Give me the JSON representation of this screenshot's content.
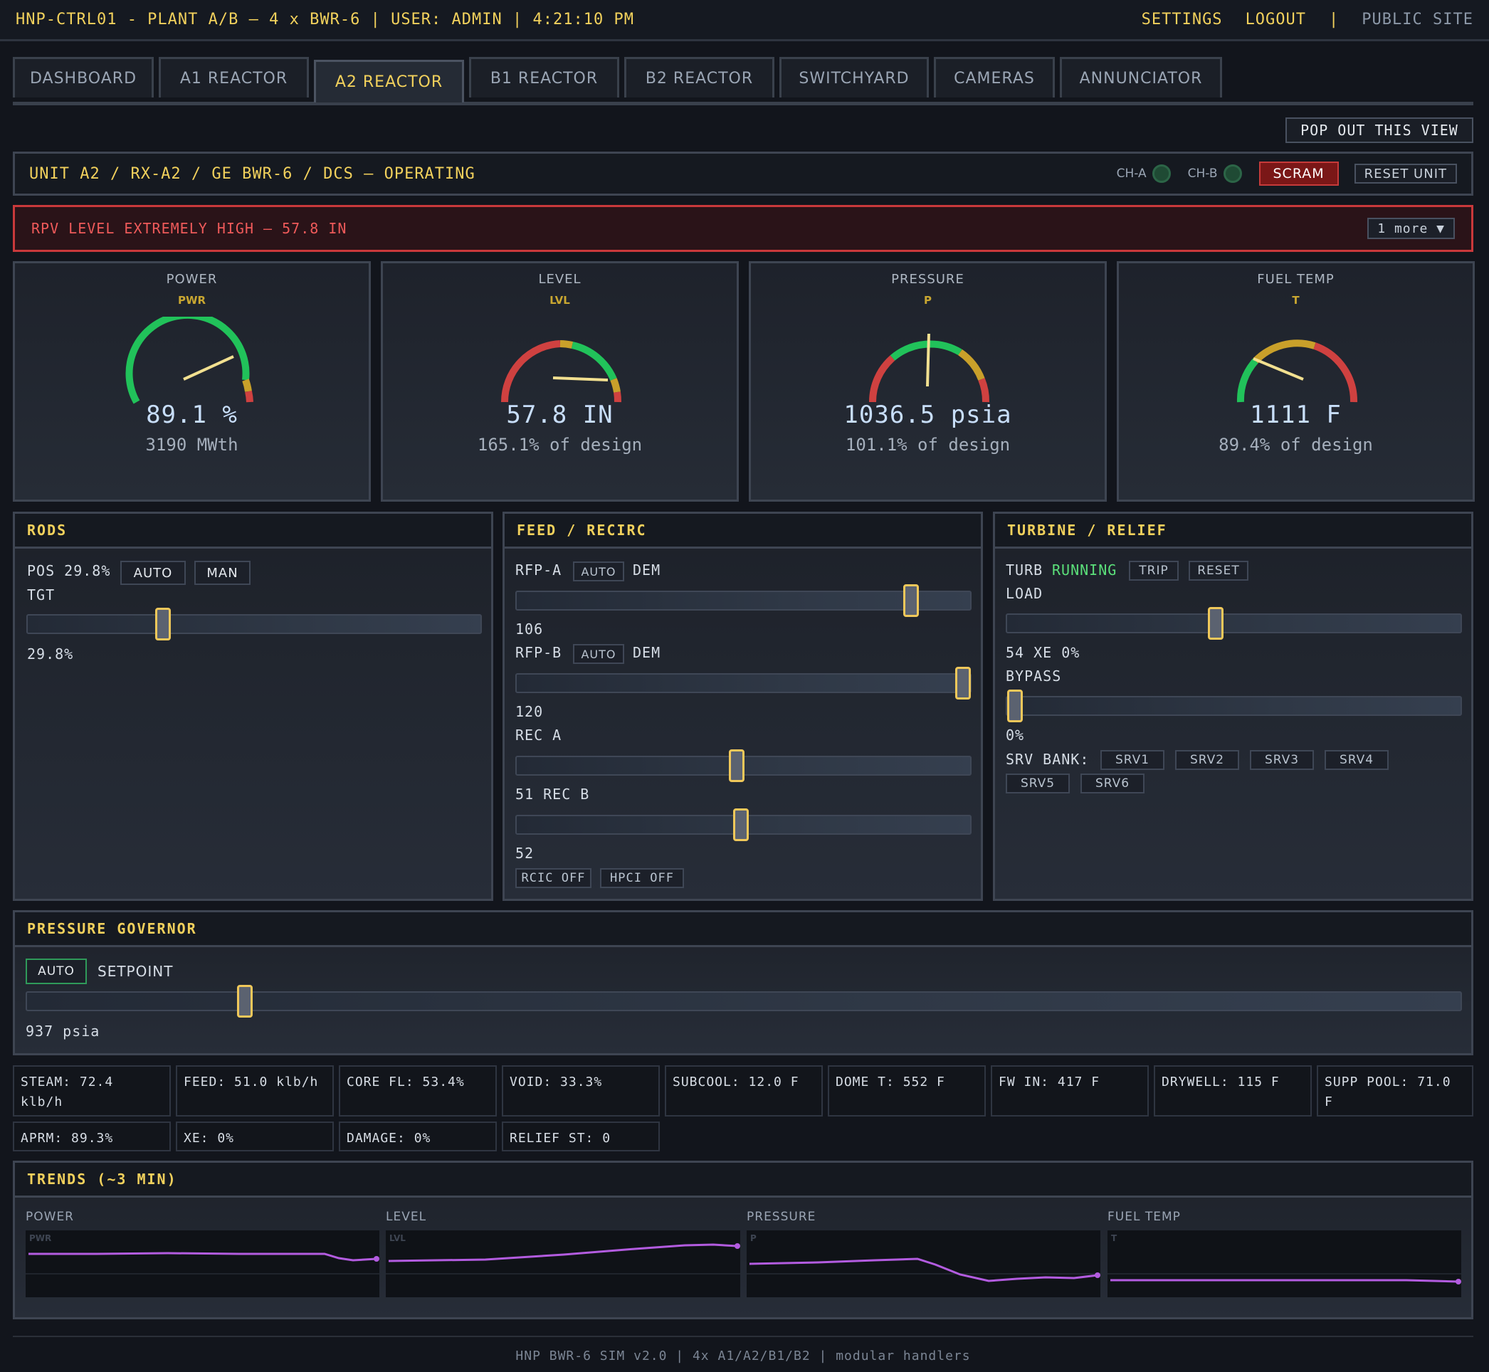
{
  "topbar": {
    "title": "HNP-CTRL01 - PLANT A/B — 4 x BWR-6 | USER: ADMIN | 4:21:10 PM",
    "settings": "SETTINGS",
    "logout": "LOGOUT",
    "sep": "|",
    "public_site": "PUBLIC SITE"
  },
  "tabs": [
    "DASHBOARD",
    "A1 REACTOR",
    "A2 REACTOR",
    "B1 REACTOR",
    "B2 REACTOR",
    "SWITCHYARD",
    "CAMERAS",
    "ANNUNCIATOR"
  ],
  "active_tab": "A2 REACTOR",
  "popout": "POP OUT THIS VIEW",
  "unit": {
    "title": "UNIT A2 / RX-A2 / GE BWR-6 / DCS — OPERATING",
    "ch_a": "CH-A",
    "ch_b": "CH-B",
    "scram": "SCRAM",
    "reset": "RESET UNIT"
  },
  "alarm": {
    "message": "RPV LEVEL EXTREMELY HIGH — 57.8 IN",
    "more": "1 more ▼"
  },
  "gauges": [
    {
      "name": "POWER",
      "abbr": "PWR",
      "value": "89.1 %",
      "sub": "3190 MWth",
      "fraction": 0.891,
      "zones": "green-high"
    },
    {
      "name": "LEVEL",
      "abbr": "LVL",
      "value": "57.8 IN",
      "sub": "165.1% of design",
      "fraction": 0.81,
      "zones": "green-mid-right"
    },
    {
      "name": "PRESSURE",
      "abbr": "P",
      "value": "1036.5 psia",
      "sub": "101.1% of design",
      "fraction": 0.506,
      "zones": "green-mid"
    },
    {
      "name": "FUEL TEMP",
      "abbr": "T",
      "value": "1111 F",
      "sub": "89.4% of design",
      "fraction": 0.232,
      "zones": "green-low"
    }
  ],
  "rods": {
    "header": "RODS",
    "pos_label": "POS 29.8%",
    "auto": "AUTO",
    "man": "MAN",
    "tgt_label": "TGT",
    "target_value": "29.8%",
    "slider": 0.298
  },
  "feed": {
    "header": "FEED / RECIRC",
    "rfp_a": "RFP-A",
    "rfp_a_mode": "AUTO",
    "rfp_a_dem": "DEM",
    "rfp_a_value": "106",
    "rfp_a_slider": 0.87,
    "rfp_b": "RFP-B",
    "rfp_b_mode": "AUTO",
    "rfp_b_dem": "DEM",
    "rfp_b_value": "120",
    "rfp_b_slider": 0.985,
    "rec_a": "REC A",
    "rec_a_slider": 0.485,
    "rec_a_value_b_label": "51 REC B",
    "rec_b_slider": 0.495,
    "rec_b_value": "52",
    "rcic": "RCIC OFF",
    "hpci": "HPCI OFF"
  },
  "turbine": {
    "header": "TURBINE / RELIEF",
    "turb": "TURB",
    "status": "RUNNING",
    "trip": "TRIP",
    "reset": "RESET",
    "load": "LOAD",
    "load_slider": 0.46,
    "load_line": "54 XE 0%",
    "bypass": "BYPASS",
    "bypass_slider": 0.0,
    "bypass_value": "0%",
    "srv_bank": "SRV BANK:",
    "srvs": [
      "SRV1",
      "SRV2",
      "SRV3",
      "SRV4",
      "SRV5",
      "SRV6"
    ]
  },
  "governor": {
    "header": "PRESSURE GOVERNOR",
    "auto": "AUTO",
    "setpoint_label": "SETPOINT",
    "slider": 0.152,
    "value": "937 psia"
  },
  "stats": [
    "STEAM: 72.4 klb/h",
    "FEED: 51.0 klb/h",
    "CORE FL: 53.4%",
    "VOID: 33.3%",
    "SUBCOOL: 12.0 F",
    "DOME T: 552 F",
    "FW IN: 417 F",
    "DRYWELL: 115 F",
    "SUPP POOL: 71.0 F",
    "APRM: 89.3%",
    "XE: 0%",
    "DAMAGE: 0%",
    "RELIEF ST: 0"
  ],
  "trends": {
    "header": "TRENDS (~3 MIN)",
    "plots": [
      {
        "label": "POWER",
        "abbr": "PWR"
      },
      {
        "label": "LEVEL",
        "abbr": "LVL"
      },
      {
        "label": "PRESSURE",
        "abbr": "P"
      },
      {
        "label": "FUEL TEMP",
        "abbr": "T"
      }
    ]
  },
  "footer": "HNP BWR-6 SIM v2.0 | 4x A1/A2/B1/B2 | modular handlers",
  "colors": {
    "accent": "#f2d15c",
    "alarm": "#c9393b",
    "running": "#5be07a",
    "trend": "#b35ce0"
  }
}
